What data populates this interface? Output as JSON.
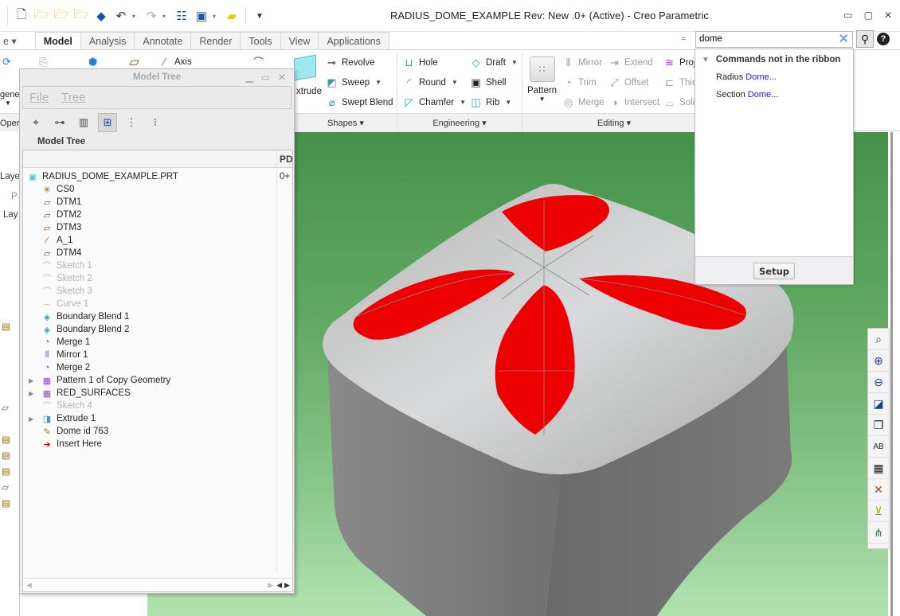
{
  "window": {
    "title": "RADIUS_DOME_EXAMPLE Rev: New .0+   (Active) - Creo Parametric",
    "controls": {
      "minimize": "▭",
      "maximize": "▢",
      "close": "✕"
    }
  },
  "quick_access": {
    "icons": [
      "new-icon",
      "open-icon",
      "open-part-icon",
      "open-assembly-icon",
      "regenerate-icon",
      "undo-icon",
      "redo-icon",
      "window-icon",
      "switch-window-icon",
      "folder-icon",
      "customize-icon"
    ]
  },
  "tabs": [
    {
      "label": "e ▾",
      "active": false,
      "stub": true
    },
    {
      "label": "Model",
      "active": true
    },
    {
      "label": "Analysis",
      "active": false
    },
    {
      "label": "Annotate",
      "active": false
    },
    {
      "label": "Render",
      "active": false
    },
    {
      "label": "Tools",
      "active": false
    },
    {
      "label": "View",
      "active": false
    },
    {
      "label": "Applications",
      "active": false
    }
  ],
  "search": {
    "value": "dome",
    "placeholder": "",
    "clear_glyph": "✕",
    "search_glyph": "⚲",
    "help_glyph": "?",
    "collapse_glyph": "≈"
  },
  "ribbon": {
    "left_stub": {
      "regenerate_label": "gener",
      "operations_label": "Opera"
    },
    "datum": {
      "axis_label": "Axis"
    },
    "extrude_label": "xtrude",
    "shapes": {
      "group_label": "Shapes ▾",
      "revolve": "Revolve",
      "sweep": "Sweep",
      "swept_blend": "Swept Blend"
    },
    "engineering": {
      "group_label": "Engineering ▾",
      "hole": "Hole",
      "round": "Round",
      "chamfer": "Chamfer",
      "draft": "Draft",
      "shell": "Shell",
      "rib": "Rib"
    },
    "editing": {
      "group_label": "Editing ▾",
      "pattern": "Pattern",
      "mirror": "Mirror",
      "trim": "Trim",
      "merge": "Merge",
      "extend": "Extend",
      "offset": "Offset",
      "intersect": "Intersect",
      "project": "Proj",
      "thicken": "Thic",
      "solidify": "Soli"
    }
  },
  "search_results": {
    "section_title": "Commands not in the ribbon",
    "items": [
      {
        "prefix": "Radius ",
        "match": "Dome",
        "suffix": "..."
      },
      {
        "prefix": "Section ",
        "match": "Dome",
        "suffix": "..."
      }
    ],
    "setup_label": "Setup"
  },
  "left_panel": {
    "layer_tab": "Laye",
    "sub_tab": "P",
    "layer_label": "Lay"
  },
  "model_tree": {
    "window_title": "Model Tree",
    "menu": [
      {
        "label": "File",
        "mnemonic": "F"
      },
      {
        "label": "Tree",
        "mnemonic": "T"
      }
    ],
    "toolbar_icons": [
      "find-icon",
      "tree-filter-icon",
      "tree-columns-icon",
      "show-tree-icon",
      "expand-all-icon",
      "collapse-all-icon"
    ],
    "label": "Model Tree",
    "column_header": "PD",
    "rows": [
      {
        "name": "RADIUS_DOME_EXAMPLE.PRT",
        "icon": "part-icon",
        "level": 0,
        "rev": "0+",
        "expandable": false,
        "suppressed": false
      },
      {
        "name": "CS0",
        "icon": "coordinate-system-icon",
        "level": 1,
        "expandable": false,
        "suppressed": false
      },
      {
        "name": "DTM1",
        "icon": "datum-plane-icon",
        "level": 1,
        "expandable": false,
        "suppressed": false
      },
      {
        "name": "DTM2",
        "icon": "datum-plane-icon",
        "level": 1,
        "expandable": false,
        "suppressed": false
      },
      {
        "name": "DTM3",
        "icon": "datum-plane-icon",
        "level": 1,
        "expandable": false,
        "suppressed": false
      },
      {
        "name": "A_1",
        "icon": "datum-axis-icon",
        "level": 1,
        "expandable": false,
        "suppressed": false
      },
      {
        "name": "DTM4",
        "icon": "datum-plane-icon",
        "level": 1,
        "expandable": false,
        "suppressed": false
      },
      {
        "name": "Sketch 1",
        "icon": "sketch-icon",
        "level": 1,
        "expandable": false,
        "suppressed": true
      },
      {
        "name": "Sketch 2",
        "icon": "sketch-icon",
        "level": 1,
        "expandable": false,
        "suppressed": true
      },
      {
        "name": "Sketch 3",
        "icon": "sketch-icon",
        "level": 1,
        "expandable": false,
        "suppressed": true
      },
      {
        "name": "Curve 1",
        "icon": "curve-icon",
        "level": 1,
        "expandable": false,
        "suppressed": true
      },
      {
        "name": "Boundary Blend 1",
        "icon": "boundary-blend-icon",
        "level": 1,
        "expandable": false,
        "suppressed": false
      },
      {
        "name": "Boundary Blend 2",
        "icon": "boundary-blend-icon",
        "level": 1,
        "expandable": false,
        "suppressed": false
      },
      {
        "name": "Merge 1",
        "icon": "merge-icon",
        "level": 1,
        "expandable": false,
        "suppressed": false
      },
      {
        "name": "Mirror 1",
        "icon": "mirror-icon",
        "level": 1,
        "expandable": false,
        "suppressed": false
      },
      {
        "name": "Merge 2",
        "icon": "merge-icon",
        "level": 1,
        "expandable": false,
        "suppressed": false
      },
      {
        "name": "Pattern 1 of Copy Geometry",
        "icon": "pattern-icon",
        "level": 1,
        "expandable": true,
        "suppressed": false
      },
      {
        "name": "RED_SURFACES",
        "icon": "pattern-icon",
        "level": 1,
        "expandable": true,
        "suppressed": false
      },
      {
        "name": "Sketch 4",
        "icon": "sketch-icon",
        "level": 1,
        "expandable": false,
        "suppressed": true
      },
      {
        "name": "Extrude 1",
        "icon": "extrude-icon",
        "level": 1,
        "expandable": true,
        "suppressed": false
      },
      {
        "name": "Dome id 763",
        "icon": "dome-icon",
        "level": 1,
        "expandable": false,
        "suppressed": false
      },
      {
        "name": "Insert Here",
        "icon": "insert-here-icon",
        "level": 1,
        "expandable": false,
        "suppressed": false
      }
    ]
  },
  "view_toolbar": {
    "icons": [
      "refit-icon",
      "zoom-in-icon",
      "zoom-out-icon",
      "repaint-icon",
      "display-style-icon",
      "saved-orientations-icon",
      "view-manager-icon",
      "datum-display-icon",
      "annotation-display-icon",
      "spin-center-icon"
    ]
  },
  "colors": {
    "background_top": "#46924a",
    "background_bottom": "#b1e3b1",
    "model_gray": "#c8c8c8",
    "model_side": "#6e6e6e",
    "highlight_red": "#ee0000",
    "search_match": "#1a1ae0"
  }
}
